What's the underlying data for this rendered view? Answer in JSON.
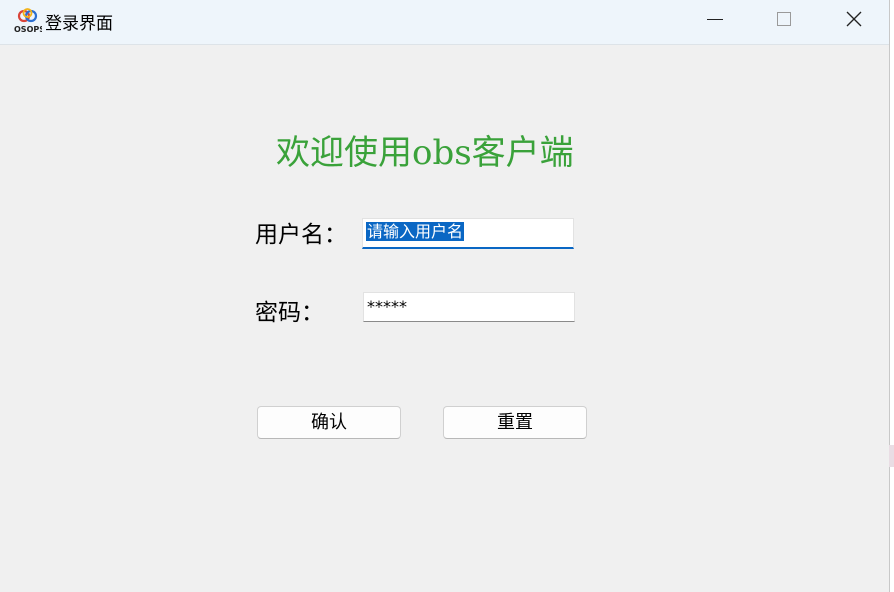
{
  "window": {
    "title": "登录界面",
    "app_icon_text": "OSOPS",
    "controls": [
      "minimize-icon",
      "maximize-icon",
      "close-icon"
    ]
  },
  "form": {
    "welcome": "欢迎使用obs客户端",
    "username_label": "用户名：",
    "username_value": "请输入用户名",
    "password_label": "密码：",
    "password_value": "*****",
    "confirm_label": "确认",
    "reset_label": "重置"
  },
  "colors": {
    "welcome_text": "#3aa23a",
    "focus_accent": "#0a67c4",
    "window_background": "#f0f0f0",
    "titlebar_background": "#eef5fb"
  }
}
